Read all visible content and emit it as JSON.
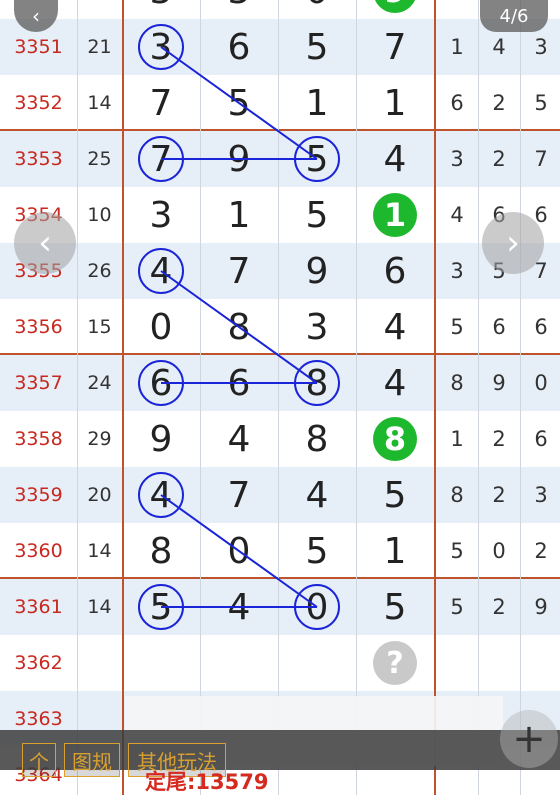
{
  "header": {
    "pager_text": "4/6",
    "back_icon": "chevron-left-icon"
  },
  "rows": [
    {
      "period": "",
      "sum": "",
      "d": [
        "3",
        "3",
        "0",
        ""
      ],
      "r": [
        "",
        "",
        ""
      ],
      "ball": {
        "col": 3,
        "text": "9",
        "color": "green"
      },
      "alt": false,
      "sep": false
    },
    {
      "period": "3351",
      "sum": "21",
      "d": [
        "3",
        "6",
        "5",
        "7"
      ],
      "r": [
        "1",
        "4",
        "3"
      ],
      "alt": true,
      "sep": false
    },
    {
      "period": "3352",
      "sum": "14",
      "d": [
        "7",
        "5",
        "1",
        "1"
      ],
      "r": [
        "6",
        "2",
        "5"
      ],
      "alt": false,
      "sep": true
    },
    {
      "period": "3353",
      "sum": "25",
      "d": [
        "7",
        "9",
        "5",
        "4"
      ],
      "r": [
        "3",
        "2",
        "7"
      ],
      "alt": true,
      "sep": false
    },
    {
      "period": "3354",
      "sum": "10",
      "d": [
        "3",
        "1",
        "5",
        ""
      ],
      "r": [
        "4",
        "6",
        "6"
      ],
      "ball": {
        "col": 3,
        "text": "1",
        "color": "green"
      },
      "alt": false,
      "sep": false
    },
    {
      "period": "3355",
      "sum": "26",
      "d": [
        "4",
        "7",
        "9",
        "6"
      ],
      "r": [
        "3",
        "5",
        "7"
      ],
      "alt": true,
      "sep": false
    },
    {
      "period": "3356",
      "sum": "15",
      "d": [
        "0",
        "8",
        "3",
        "4"
      ],
      "r": [
        "5",
        "6",
        "6"
      ],
      "alt": false,
      "sep": true
    },
    {
      "period": "3357",
      "sum": "24",
      "d": [
        "6",
        "6",
        "8",
        "4"
      ],
      "r": [
        "8",
        "9",
        "0"
      ],
      "alt": true,
      "sep": false
    },
    {
      "period": "3358",
      "sum": "29",
      "d": [
        "9",
        "4",
        "8",
        ""
      ],
      "r": [
        "1",
        "2",
        "6"
      ],
      "ball": {
        "col": 3,
        "text": "8",
        "color": "green"
      },
      "alt": false,
      "sep": false
    },
    {
      "period": "3359",
      "sum": "20",
      "d": [
        "4",
        "7",
        "4",
        "5"
      ],
      "r": [
        "8",
        "2",
        "3"
      ],
      "alt": true,
      "sep": false
    },
    {
      "period": "3360",
      "sum": "14",
      "d": [
        "8",
        "0",
        "5",
        "1"
      ],
      "r": [
        "5",
        "0",
        "2"
      ],
      "alt": false,
      "sep": true
    },
    {
      "period": "3361",
      "sum": "14",
      "d": [
        "5",
        "4",
        "0",
        "5"
      ],
      "r": [
        "5",
        "2",
        "9"
      ],
      "alt": true,
      "sep": false
    },
    {
      "period": "3362",
      "sum": "",
      "d": [
        "",
        "",
        "",
        ""
      ],
      "r": [
        "",
        "",
        ""
      ],
      "ball": {
        "col": 3,
        "text": "?",
        "color": "grey"
      },
      "alt": false,
      "sep": false
    },
    {
      "period": "3363",
      "sum": "",
      "d": [
        "",
        "",
        "",
        ""
      ],
      "r": [
        "",
        "",
        ""
      ],
      "alt": true,
      "sep": false
    },
    {
      "period": "3364",
      "sum": "",
      "d": [
        "",
        "",
        "",
        ""
      ],
      "r": [
        "",
        "",
        ""
      ],
      "alt": false,
      "sep": false
    }
  ],
  "circles": [
    {
      "row": 1,
      "col": 0
    },
    {
      "row": 3,
      "col": 0
    },
    {
      "row": 3,
      "col": 2
    },
    {
      "row": 5,
      "col": 0
    },
    {
      "row": 7,
      "col": 0
    },
    {
      "row": 7,
      "col": 2
    },
    {
      "row": 9,
      "col": 0
    },
    {
      "row": 11,
      "col": 0
    },
    {
      "row": 11,
      "col": 2
    }
  ],
  "lines": [
    {
      "from": [
        1,
        0
      ],
      "to": [
        3,
        2
      ]
    },
    {
      "from": [
        3,
        0
      ],
      "to": [
        3,
        2
      ]
    },
    {
      "from": [
        5,
        0
      ],
      "to": [
        7,
        2
      ]
    },
    {
      "from": [
        7,
        0
      ],
      "to": [
        7,
        2
      ]
    },
    {
      "from": [
        9,
        0
      ],
      "to": [
        11,
        2
      ]
    },
    {
      "from": [
        11,
        0
      ],
      "to": [
        11,
        2
      ]
    }
  ],
  "toolbar": {
    "btn_single": "个",
    "btn_chart": "图规",
    "btn_other": "其他玩法",
    "note": "定尾:13579"
  },
  "colors": {
    "accent": "#c0522c",
    "green": "#1db82e",
    "line": "#1a24d8",
    "period": "#c8281e"
  }
}
